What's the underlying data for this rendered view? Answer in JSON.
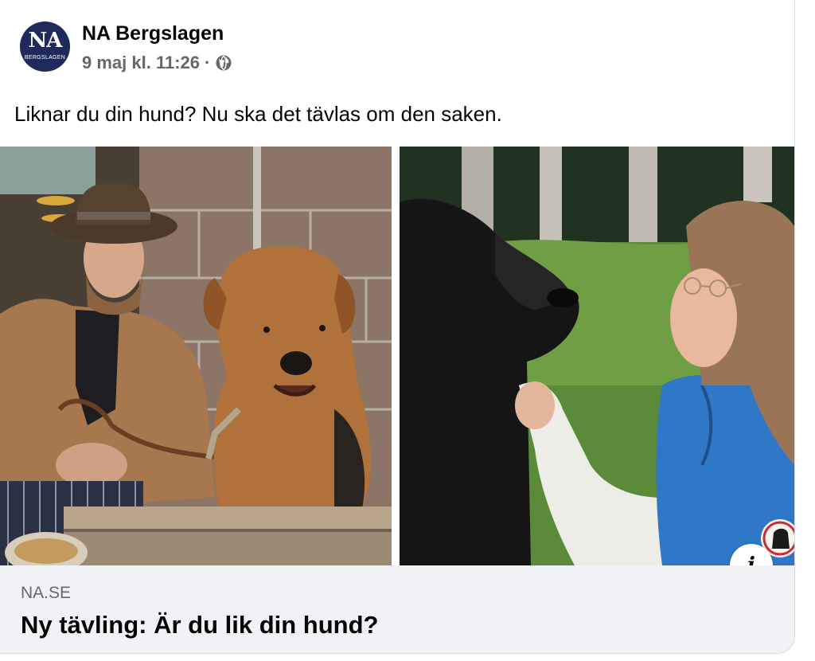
{
  "post": {
    "avatar_text": "NA",
    "avatar_subtext": "BERGSLAGEN",
    "page_name": "NA Bergslagen",
    "timestamp": "9 maj kl. 11:26",
    "separator": "·",
    "privacy_icon": "globe-icon",
    "text": "Liknar du din hund? Nu ska det tävlas om den saken."
  },
  "link_preview": {
    "domain": "NA.SE",
    "title": "Ny tävling: Är du lik din hund?",
    "info_icon": "info-icon",
    "info_label": "i"
  },
  "colors": {
    "avatar_bg": "#1f2a5c",
    "link_box_bg": "#f0f2f5",
    "secondary_text": "#65676b",
    "primary_text": "#050505"
  }
}
